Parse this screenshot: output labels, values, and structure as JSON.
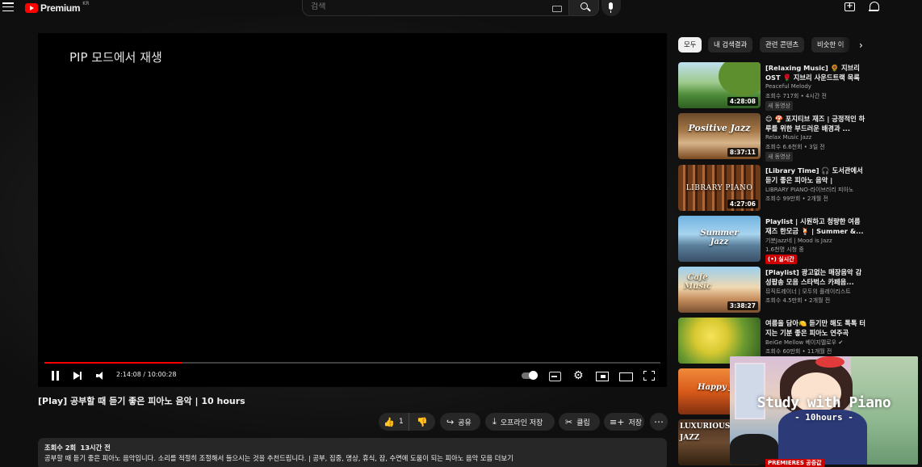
{
  "header": {
    "logo_text": "Premium",
    "logo_region": "KR",
    "search_placeholder": "검색"
  },
  "player": {
    "overlay_text": "PIP 모드에서 재생",
    "time_display": "2:14:08 / 10:00:28",
    "progress_fraction": 0.223,
    "accent_color": "#ff0000"
  },
  "video": {
    "title": "[Play] 공부할 때 듣기 좋은 피아노 음악 | 10 hours",
    "likes": "1",
    "share_label": "공유",
    "offline_label": "오프라인 저장",
    "clip_label": "클립",
    "save_label": "저장",
    "views": "조회수 2회",
    "age": "13시간 전",
    "description": "공부할 때 듣기 좋은 피아노 음악입니다. 소리를 적절히 조절해서 들으시는 것을 추천드립니다. | 공부, 집중, 명상, 휴식, 잠, 수면에 도움이 되는 피아노 음악 모음 더보기"
  },
  "chips": [
    "모두",
    "내 검색결과",
    "관련 콘텐츠",
    "비슷한 이"
  ],
  "recommendations": [
    {
      "title": "[Relaxing Music] 🌻 지브리 OST 🌹 지브리 사운드트랙 목록 ...",
      "channel": "Peaceful Melody",
      "meta": "조회수 717회 • 4시간 전",
      "badge": "새 동영상",
      "duration": "4:28:08",
      "thumb_text": ""
    },
    {
      "title": "😊 🍄 포지티브 재즈 | 긍정적인 하루를 위한 부드러운 배경과 ...",
      "channel": "Relax Music Jazz",
      "meta": "조회수 6.6천회 • 3일 전",
      "badge": "새 동영상",
      "duration": "8:37:11",
      "thumb_text": "Positive Jazz"
    },
    {
      "title": "[Library Time] 🎧 도서관에서 듣기 좋은 피아노 음악 | Relaxing...",
      "channel": "LIBRARY PIANO-라이브러리 피아노",
      "meta": "조회수 99만회 • 2개월 전",
      "badge": "",
      "duration": "4:27:06",
      "thumb_text": "LIBRARY PIANO"
    },
    {
      "title": "Playlist | 시원하고 청량한 여름 재즈 한모금 🍹 | Summer &...",
      "channel": "기분Jazz네 | Mood is Jazz",
      "meta": "1.6천명 시청 중",
      "badge": "(•) 실시간",
      "duration": "",
      "thumb_text": "Summer Jazz"
    },
    {
      "title": "[Playlist] 광고없는 매장음악 감성팝송 모음 스타벅스 카페음...",
      "channel": "뮤직트레이너 | 모두의 플레이리스트",
      "meta": "조회수 4.5만회 • 2개월 전",
      "badge": "",
      "duration": "3:38:27",
      "thumb_text": "Cafe Music"
    },
    {
      "title": "여름을 담아🍋 듣기만 해도 톡톡 터지는 기분 좋은 피아노 연주곡",
      "channel": "BeiGe Mellow 베이지멜로우 ✔",
      "meta": "조회수 60만회 • 11개월 전",
      "badge": "",
      "duration": "",
      "thumb_text": ""
    },
    {
      "title": "",
      "channel": "",
      "meta": "",
      "badge": "",
      "duration": "",
      "thumb_text": "Happy J"
    },
    {
      "title": "",
      "channel": "",
      "meta": "",
      "badge": "",
      "duration": "",
      "thumb_text": "LUXURIOUS JAZZ"
    }
  ],
  "pip": {
    "title": "Study with Piano",
    "subtitle": "- 10hours -"
  },
  "bottom_badge": "PREMIERES 공중값"
}
